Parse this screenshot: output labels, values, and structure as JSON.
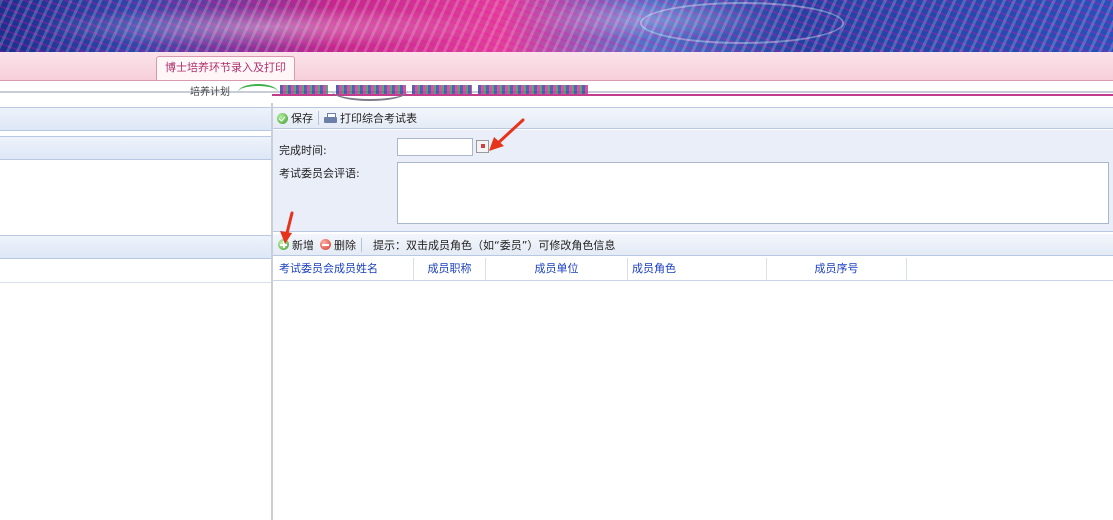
{
  "header": {
    "tab_label": "博士培养环节录入及打印"
  },
  "subtabs": {
    "plan_label": "培养计划"
  },
  "toolbar": {
    "save_label": "保存",
    "print_label": "打印综合考试表"
  },
  "form": {
    "completion_time_label": "完成时间:",
    "completion_time_value": "",
    "committee_comment_label": "考试委员会评语:",
    "committee_comment_value": ""
  },
  "members_toolbar": {
    "add_label": "新增",
    "delete_label": "删除",
    "hint": "提示：双击成员角色（如“委员”）可修改角色信息"
  },
  "members_table": {
    "columns": [
      "考试委员会成员姓名",
      "成员职称",
      "成员单位",
      "成员角色",
      "成员序号"
    ],
    "rows": []
  },
  "annotations": {
    "arrow_color": "#e8331c"
  }
}
